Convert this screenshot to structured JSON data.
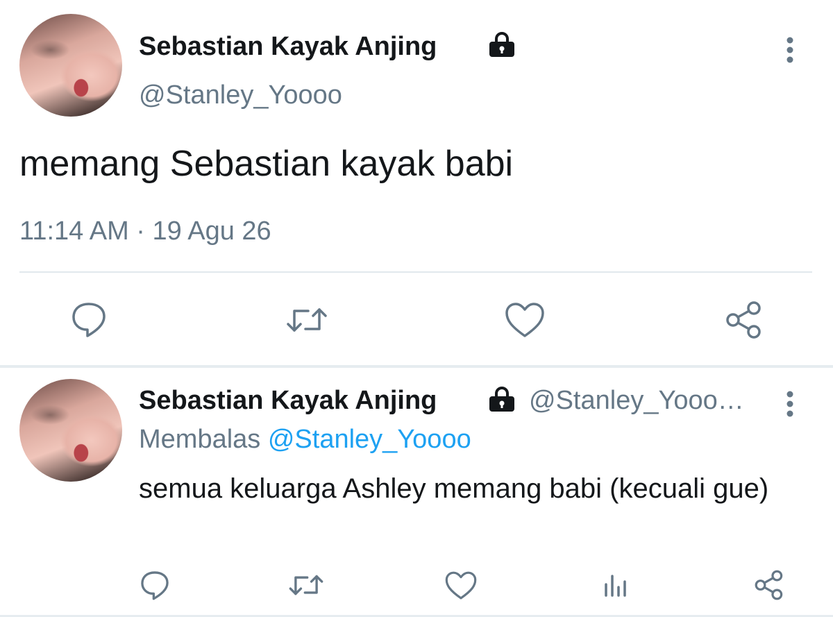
{
  "main_tweet": {
    "author": {
      "display_name": "Sebastian Kayak Anjing",
      "handle": "@Stanley_Yoooo",
      "protected": true
    },
    "text": "memang Sebastian kayak babi",
    "timestamp": "11:14 AM · 19 Agu 26",
    "actions": [
      "reply-icon",
      "retweet-icon",
      "like-icon",
      "share-icon"
    ]
  },
  "reply_tweet": {
    "author": {
      "display_name": "Sebastian Kayak Anjing",
      "handle": "@Stanley_Yooo…",
      "protected": true
    },
    "replying_label": "Membalas",
    "replying_to": "@Stanley_Yoooo",
    "text": "semua keluarga Ashley memang babi (kecuali gue)",
    "actions": [
      "reply-icon",
      "retweet-icon",
      "like-icon",
      "analytics-icon",
      "share-icon"
    ]
  },
  "colors": {
    "text": "#14171a",
    "secondary": "#657786",
    "link": "#1da1f2",
    "divider": "#e1e8ed",
    "icon": "#657786"
  }
}
